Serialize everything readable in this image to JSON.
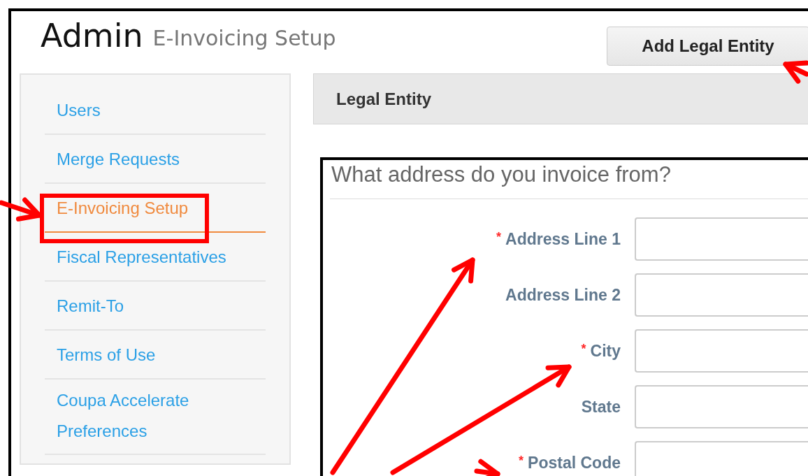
{
  "header": {
    "title": "Admin",
    "subtitle": "E-Invoicing Setup",
    "action_button": "Add Legal Entity"
  },
  "sidebar": {
    "items": [
      {
        "label": "Users",
        "selected": false
      },
      {
        "label": "Merge Requests",
        "selected": false
      },
      {
        "label": "E-Invoicing Setup",
        "selected": true
      },
      {
        "label": "Fiscal Representatives",
        "selected": false
      },
      {
        "label": "Remit-To",
        "selected": false
      },
      {
        "label": "Terms of Use",
        "selected": false
      },
      {
        "label": "Coupa Accelerate Preferences",
        "selected": false
      }
    ]
  },
  "panel": {
    "title": "Legal Entity"
  },
  "form": {
    "heading": "What address do you invoice from?",
    "fields": [
      {
        "label": "Address Line 1",
        "required_mark": "*"
      },
      {
        "label": "Address Line 2"
      },
      {
        "label": "City",
        "required_mark": "*"
      },
      {
        "label": "State"
      },
      {
        "label": "Postal Code",
        "required_mark": "*"
      }
    ]
  }
}
